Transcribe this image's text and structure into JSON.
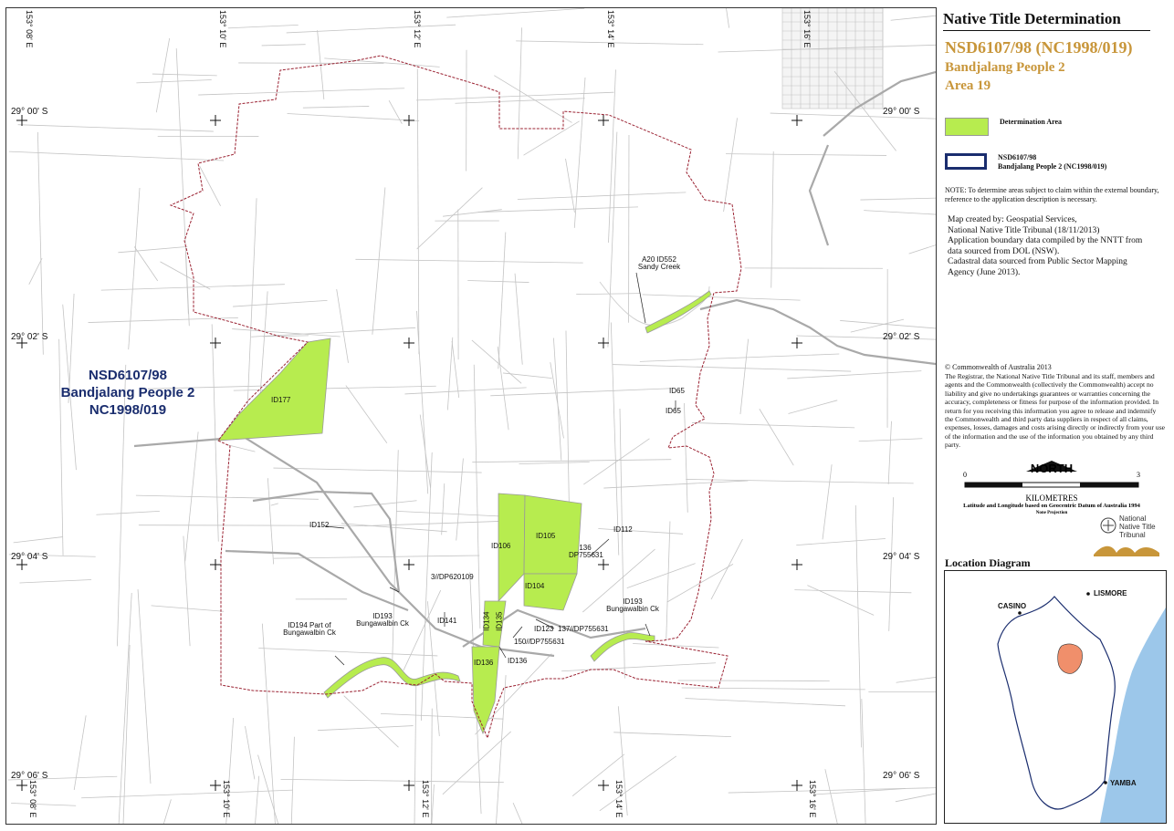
{
  "panel": {
    "title": "Native Title Determination",
    "application_number": "NSD6107/98 (NC1998/019)",
    "claim_name": "Bandjalang People 2",
    "area": "Area 19",
    "legend": [
      {
        "label": "Determination Area",
        "color": "#b7ec4f"
      },
      {
        "label_line1": "NSD6107/98",
        "label_line2": "Bandjalang People 2 (NC1998/019)",
        "color": "#1a2d6e"
      }
    ],
    "note": "NOTE: To determine areas subject to claim within the external boundary, reference to the application description is necessary.",
    "map_created": [
      "Map created by: Geospatial Services,",
      "National Native Title Tribunal   (18/11/2013)",
      "Application boundary data compiled by the NNTT from",
      "data sourced from DOL (NSW).",
      "Cadastral data sourced from Public Sector Mapping",
      "Agency (June 2013)."
    ],
    "copyright": "© Commonwealth of Australia 2013",
    "disclaimer": "The Registrar, the National Native Title Tribunal and its staff, members and agents and the Commonwealth (collectively the Commonwealth) accept no liability and give no undertakings guarantees or warranties concerning the accuracy, completeness or fitness for purpose of the information provided. In return for you receiving this information you agree to release and indemnify the Commonwealth and third party data suppliers in respect of all claims, expenses, losses, damages and costs arising directly or indirectly from your use of the information and the use of the information you obtained by any third party.",
    "north": "NORTH",
    "scale": {
      "min": "0",
      "max": "3",
      "unit": "KILOMETRES"
    },
    "datum": "Latitude and Longitude based on Geocentric Datum of Australia 1994",
    "projection": "None Projection",
    "logo_text": [
      "National",
      "Native Title",
      "Tribunal"
    ],
    "location_diagram": {
      "title": "Location Diagram",
      "places": [
        "CASINO",
        "LISMORE",
        "YAMBA"
      ]
    }
  },
  "map": {
    "claim_label": [
      "NSD6107/98",
      "Bandjalang People 2",
      "NC1998/019"
    ],
    "lat_labels": [
      "29° 00' S",
      "29° 00' S",
      "29° 02' S",
      "29° 02' S",
      "29° 04' S",
      "29° 04' S",
      "29° 06' S",
      "29° 06' S"
    ],
    "lon_labels": [
      "153° 08' E",
      "153° 10' E",
      "153° 12' E",
      "153° 14' E",
      "153° 16' E",
      "153° 08' E",
      "153° 10' E",
      "153° 12' E",
      "153° 14' E",
      "153° 16' E"
    ],
    "parcel_labels": [
      "ID177",
      "ID106",
      "ID105",
      "ID104",
      "ID134",
      "ID135",
      "ID136",
      "ID136",
      "ID152",
      "ID141",
      "ID123",
      "ID112",
      "ID65",
      "ID65",
      "3//DP620109",
      "136 DP755631",
      "137//DP755631",
      "150//DP755631",
      "A20 ID552 Sandy Creek",
      "ID194 Part of Bungawalbin Ck",
      "ID193 Bungawalbin Ck",
      "ID193 Bungawalbin Ck"
    ],
    "colors": {
      "determination": "#b7ec4f",
      "boundary": "#9b2333",
      "cadastre": "#bdbdbd",
      "road": "#a8a8a8"
    }
  }
}
